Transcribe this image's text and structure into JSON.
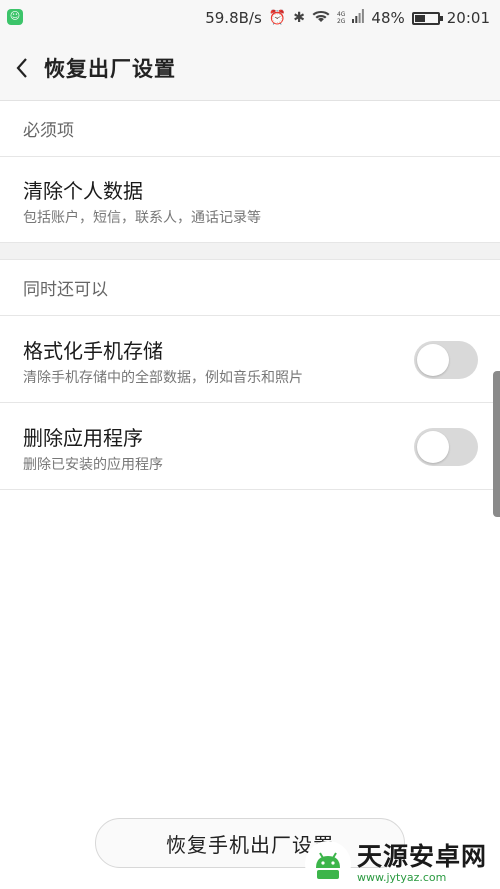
{
  "statusbar": {
    "speed": "59.8B/s",
    "net_4g": "4G",
    "net_2g": "2G",
    "battery": "48%",
    "battery_level": 0.48,
    "time": "20:01"
  },
  "header": {
    "title": "恢复出厂设置"
  },
  "sections": {
    "required": {
      "title": "必须项",
      "items": [
        {
          "title": "清除个人数据",
          "subtitle": "包括账户，短信，联系人，通话记录等"
        }
      ]
    },
    "optional": {
      "title": "同时还可以",
      "items": [
        {
          "title": "格式化手机存储",
          "subtitle": "清除手机存储中的全部数据，例如音乐和照片",
          "enabled": false
        },
        {
          "title": "删除应用程序",
          "subtitle": "删除已安装的应用程序",
          "enabled": false
        }
      ]
    }
  },
  "bottom_button": {
    "label": "恢复手机出厂设置"
  },
  "watermark": {
    "name": "天源安卓网",
    "url": "www.jytyaz.com"
  },
  "colors": {
    "toggle_off": "#d9d9d9",
    "accent_green": "#3cc46a"
  }
}
